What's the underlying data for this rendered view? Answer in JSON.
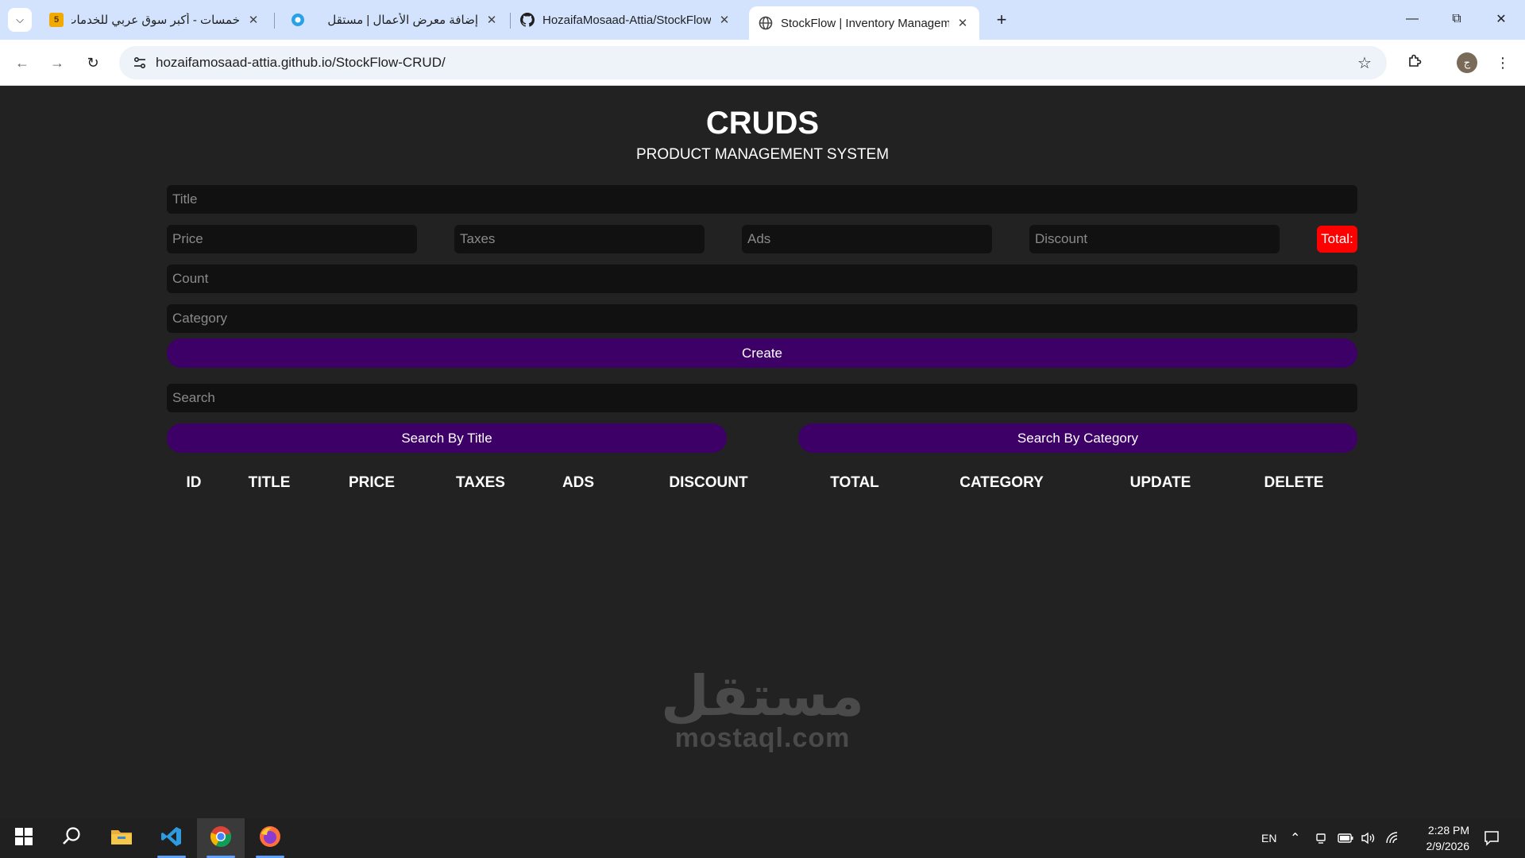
{
  "browser": {
    "tabs": [
      {
        "title": "خمسات - أكبر سوق عربي للخدمات",
        "favicon_text": "5",
        "favicon_color": "#f2a900"
      },
      {
        "title": "إضافة معرض الأعمال | مستقل",
        "favicon_color": "#2aa0e8"
      },
      {
        "title": "HozaifaMosaad-Attia/StockFlow",
        "favicon": "github-icon"
      },
      {
        "title": "StockFlow | Inventory Management",
        "favicon": "globe-icon",
        "active": true
      }
    ],
    "url": "hozaifamosaad-attia.github.io/StockFlow-CRUD/",
    "profile_initial": "ج"
  },
  "app": {
    "title": "CRUDS",
    "subtitle": "PRODUCT MANAGEMENT SYSTEM",
    "form": {
      "title_placeholder": "Title",
      "price_placeholder": "Price",
      "taxes_placeholder": "Taxes",
      "ads_placeholder": "Ads",
      "discount_placeholder": "Discount",
      "total_label": "Total:",
      "count_placeholder": "Count",
      "category_placeholder": "Category",
      "create_label": "Create"
    },
    "search": {
      "placeholder": "Search",
      "by_title_label": "Search By Title",
      "by_category_label": "Search By Category"
    },
    "table": {
      "headers": [
        "ID",
        "TITLE",
        "PRICE",
        "TAXES",
        "ADS",
        "DISCOUNT",
        "TOTAL",
        "CATEGORY",
        "UPDATE",
        "DELETE"
      ]
    },
    "colors": {
      "background": "#222222",
      "input_bg": "#111111",
      "button_bg": "#3d0066",
      "total_bg": "#ff0000"
    }
  },
  "watermark": {
    "arabic": "مستقل",
    "latin": "mostaql.com"
  },
  "taskbar": {
    "language": "EN",
    "time": "2:28 PM",
    "date": "2/9/2026"
  }
}
